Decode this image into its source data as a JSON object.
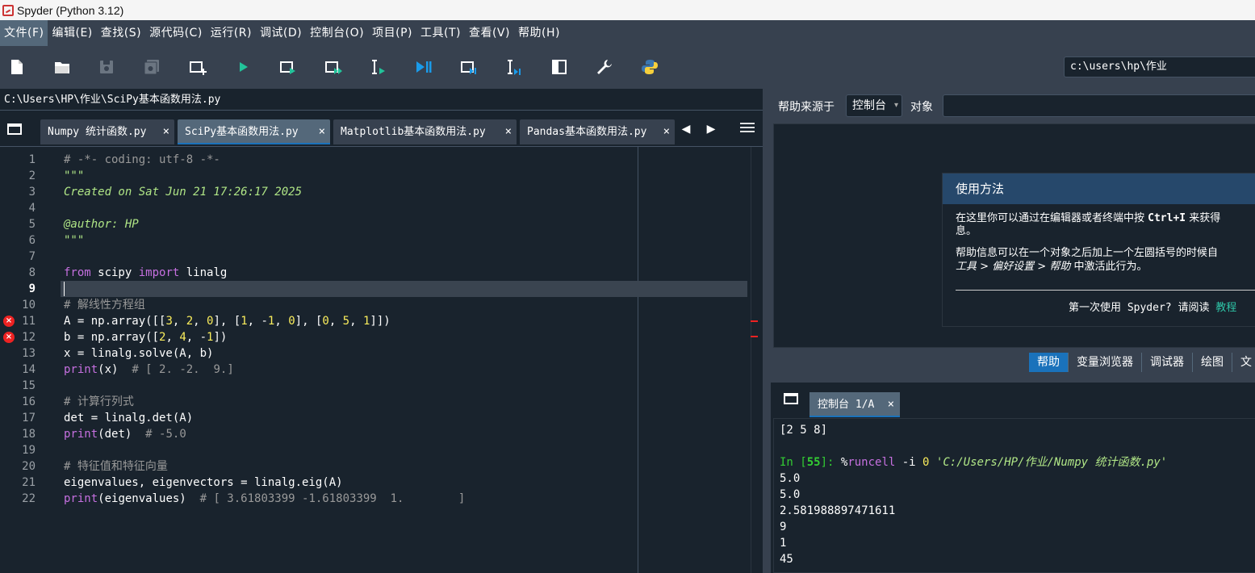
{
  "window": {
    "title": "Spyder (Python 3.12)"
  },
  "menu": [
    "文件(F)",
    "编辑(E)",
    "查找(S)",
    "源代码(C)",
    "运行(R)",
    "调试(D)",
    "控制台(O)",
    "项目(P)",
    "工具(T)",
    "查看(V)",
    "帮助(H)"
  ],
  "toolbar": {
    "icons": [
      "new-file-icon",
      "open-file-icon",
      "save-icon",
      "save-all-icon",
      "new-cell-icon",
      "run-icon",
      "run-cell-icon",
      "run-cell-advance-icon",
      "run-selection-icon",
      "debug-icon",
      "debug-cell-icon",
      "debug-selection-icon",
      "maximize-pane-icon",
      "preferences-icon",
      "python-path-icon"
    ],
    "working_dir": "c:\\users\\hp\\作业"
  },
  "editor": {
    "file_path": "C:\\Users\\HP\\作业\\SciPy基本函数用法.py",
    "tabs": [
      {
        "label": "Numpy 统计函数.py",
        "close": "×"
      },
      {
        "label": "SciPy基本函数用法.py",
        "close": "×"
      },
      {
        "label": "Matplotlib基本函数用法.py",
        "close": "×"
      },
      {
        "label": "Pandas基本函数用法.py",
        "close": "×"
      }
    ],
    "nav_prev": "◀",
    "nav_next": "▶",
    "current_line": 9,
    "error_lines": [
      11,
      12
    ],
    "lines": [
      {
        "n": "1",
        "parts": [
          [
            "c-comment",
            "# -*- coding: utf-8 -*-"
          ]
        ]
      },
      {
        "n": "2",
        "parts": [
          [
            "c-doc",
            "\"\"\""
          ]
        ]
      },
      {
        "n": "3",
        "parts": [
          [
            "c-doc",
            "Created on Sat Jun 21 17:26:17 2025"
          ]
        ]
      },
      {
        "n": "4",
        "parts": []
      },
      {
        "n": "5",
        "parts": [
          [
            "c-doc",
            "@author: HP"
          ]
        ]
      },
      {
        "n": "6",
        "parts": [
          [
            "c-doc",
            "\"\"\""
          ]
        ]
      },
      {
        "n": "7",
        "parts": []
      },
      {
        "n": "8",
        "parts": [
          [
            "c-kw",
            "from"
          ],
          [
            "",
            " scipy "
          ],
          [
            "c-kw",
            "import"
          ],
          [
            "",
            " linalg"
          ]
        ]
      },
      {
        "n": "9",
        "parts": []
      },
      {
        "n": "10",
        "parts": [
          [
            "c-comment",
            "# 解线性方程组"
          ]
        ]
      },
      {
        "n": "11",
        "parts": [
          [
            "",
            "A = np.array([["
          ],
          [
            "c-num",
            "3"
          ],
          [
            "",
            ", "
          ],
          [
            "c-num",
            "2"
          ],
          [
            "",
            ", "
          ],
          [
            "c-num",
            "0"
          ],
          [
            "",
            "], ["
          ],
          [
            "c-num",
            "1"
          ],
          [
            "",
            ", -"
          ],
          [
            "c-num",
            "1"
          ],
          [
            "",
            ", "
          ],
          [
            "c-num",
            "0"
          ],
          [
            "",
            "], ["
          ],
          [
            "c-num",
            "0"
          ],
          [
            "",
            ", "
          ],
          [
            "c-num",
            "5"
          ],
          [
            "",
            ", "
          ],
          [
            "c-num",
            "1"
          ],
          [
            "",
            "]])"
          ]
        ]
      },
      {
        "n": "12",
        "parts": [
          [
            "",
            "b = np.array(["
          ],
          [
            "c-num",
            "2"
          ],
          [
            "",
            ", "
          ],
          [
            "c-num",
            "4"
          ],
          [
            "",
            ", -"
          ],
          [
            "c-num",
            "1"
          ],
          [
            "",
            "])"
          ]
        ]
      },
      {
        "n": "13",
        "parts": [
          [
            "",
            "x = linalg.solve(A, b)"
          ]
        ]
      },
      {
        "n": "14",
        "parts": [
          [
            "c-builtin",
            "print"
          ],
          [
            "",
            "(x)  "
          ],
          [
            "c-comment",
            "# [ 2. -2.  9.]"
          ]
        ]
      },
      {
        "n": "15",
        "parts": []
      },
      {
        "n": "16",
        "parts": [
          [
            "c-comment",
            "# 计算行列式"
          ]
        ]
      },
      {
        "n": "17",
        "parts": [
          [
            "",
            "det = linalg.det(A)"
          ]
        ]
      },
      {
        "n": "18",
        "parts": [
          [
            "c-builtin",
            "print"
          ],
          [
            "",
            "(det)  "
          ],
          [
            "c-comment",
            "# -5.0"
          ]
        ]
      },
      {
        "n": "19",
        "parts": []
      },
      {
        "n": "20",
        "parts": [
          [
            "c-comment",
            "# 特征值和特征向量"
          ]
        ]
      },
      {
        "n": "21",
        "parts": [
          [
            "",
            "eigenvalues, eigenvectors = linalg.eig(A)"
          ]
        ]
      },
      {
        "n": "22",
        "parts": [
          [
            "c-builtin",
            "print"
          ],
          [
            "",
            "(eigenvalues)  "
          ],
          [
            "c-comment",
            "# [ 3.61803399 -1.61803399  1.        ]"
          ]
        ]
      }
    ]
  },
  "help": {
    "source_label": "帮助来源于",
    "source_value": "控制台",
    "object_label": "对象",
    "usage": {
      "title": "使用方法",
      "p1_a": "在这里你可以通过在编辑器或者终端中按 ",
      "p1_key": "Ctrl+I",
      "p1_b": " 来获得",
      "p1_c": "息。",
      "p2_a": "帮助信息可以在一个对象之后加上一个左圆括号的时候自",
      "p2_menu": "工具 > 偏好设置 > 帮助",
      "p2_b": " 中激活此行为。",
      "tutorial_text": "第一次使用 Spyder? 请阅读 ",
      "tutorial_link": "教程"
    },
    "pane_tabs": [
      "帮助",
      "变量浏览器",
      "调试器",
      "绘图",
      "文"
    ]
  },
  "console": {
    "tab_label": "控制台 1/A",
    "tab_close": "×",
    "lines": [
      {
        "parts": [
          [
            "",
            "[2 5 8]"
          ]
        ]
      },
      {
        "parts": []
      },
      {
        "parts": [
          [
            "c-prompt",
            "In ["
          ],
          [
            "c-prompt-num",
            "55"
          ],
          [
            "c-prompt",
            "]: "
          ],
          [
            "",
            "%"
          ],
          [
            "c-magic",
            "runcell"
          ],
          [
            "",
            " -i "
          ],
          [
            "c-num",
            "0"
          ],
          [
            "",
            " "
          ],
          [
            "c-str",
            "'C:/Users/HP/作业/Numpy 统计函数.py'"
          ]
        ]
      },
      {
        "parts": [
          [
            "",
            "5.0"
          ]
        ]
      },
      {
        "parts": [
          [
            "",
            "5.0"
          ]
        ]
      },
      {
        "parts": [
          [
            "",
            "2.581988897471611"
          ]
        ]
      },
      {
        "parts": [
          [
            "",
            "9"
          ]
        ]
      },
      {
        "parts": [
          [
            "",
            "1"
          ]
        ]
      },
      {
        "parts": [
          [
            "",
            "45"
          ]
        ]
      }
    ]
  }
}
